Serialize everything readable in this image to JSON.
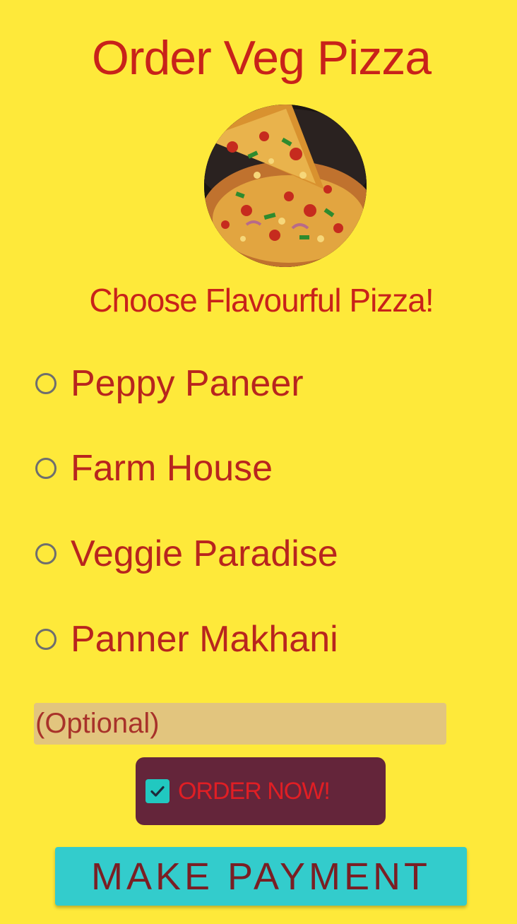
{
  "header": {
    "title": "Order Veg Pizza",
    "image_icon": "pizza-image"
  },
  "menu": {
    "heading": "Choose Flavourful Pizza!",
    "options": [
      {
        "label": "Peppy Paneer",
        "selected": false
      },
      {
        "label": "Farm House",
        "selected": false
      },
      {
        "label": "Veggie Paradise",
        "selected": false
      },
      {
        "label": "Panner Makhani",
        "selected": false
      }
    ]
  },
  "note": {
    "placeholder": "(Optional)",
    "value": ""
  },
  "order": {
    "label": "ORDER NOW!",
    "checked": true
  },
  "payment": {
    "label": "MAKE PAYMENT"
  },
  "colors": {
    "background": "#FEE93A",
    "title": "#C8221A",
    "note_field": "#E2C57E",
    "order_button": "#64253A",
    "checkbox": "#21C8C0",
    "pay_button": "#33CCCC"
  }
}
